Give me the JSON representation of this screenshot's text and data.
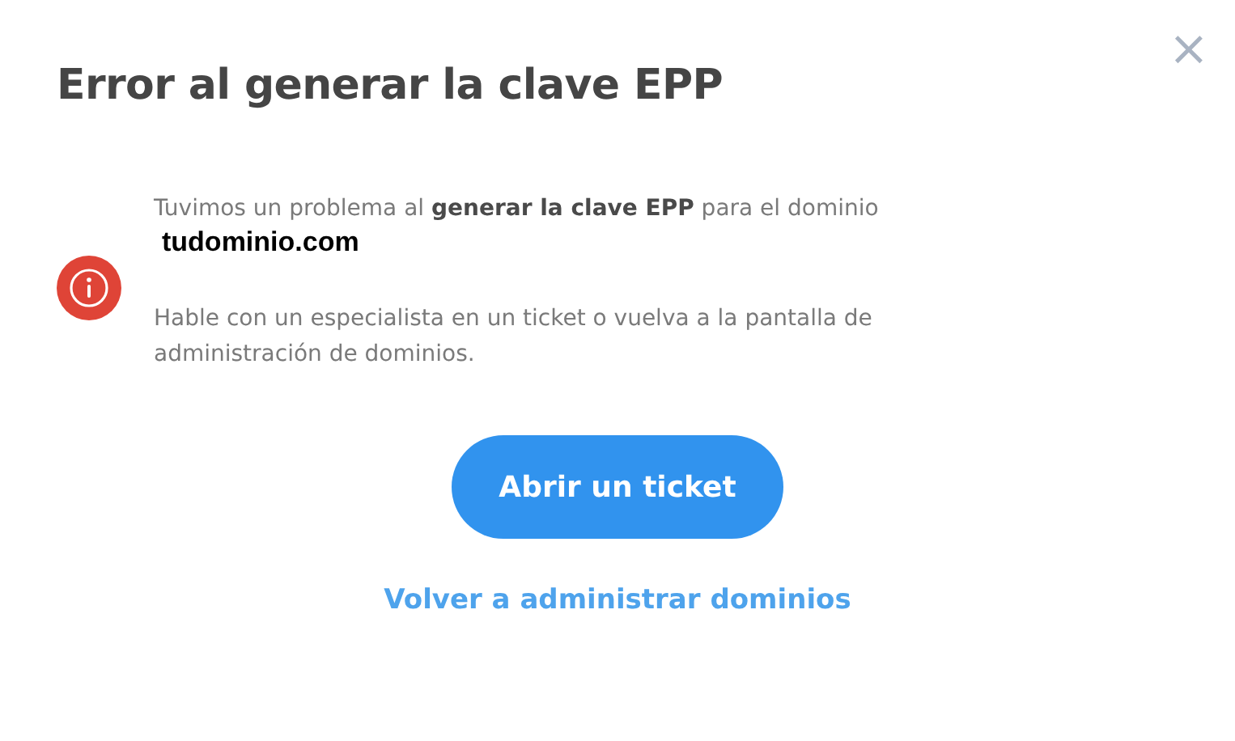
{
  "dialog": {
    "title": "Error al generar la clave EPP",
    "close": "×",
    "message": "Tuvimos un problema al **generar la clave EPP** para el dominio",
    "domain": "tudominio.com",
    "hint": "Hable con un especialista en un ticket o vuelva a la pantalla de administración de dominios.",
    "primary_button": "Abrir un ticket",
    "link": "Volver a administrar dominios"
  }
}
